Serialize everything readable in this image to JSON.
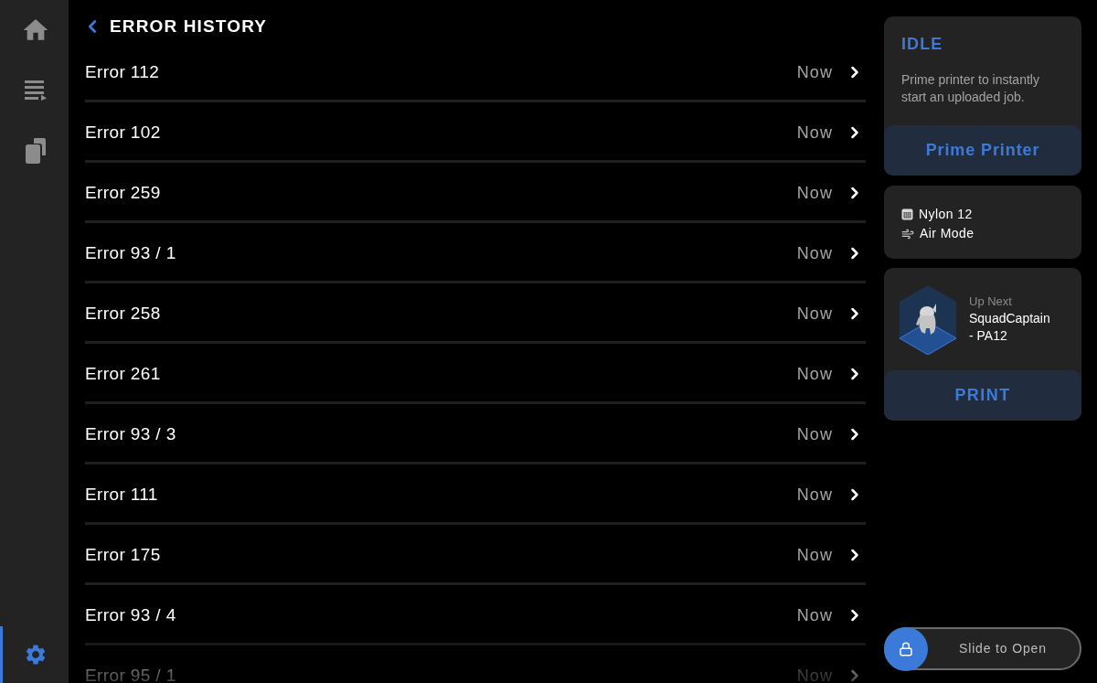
{
  "sidebar": {
    "items": [
      {
        "kind": "home",
        "selected": false
      },
      {
        "kind": "queue",
        "selected": false
      },
      {
        "kind": "library",
        "selected": false
      },
      {
        "kind": "settings",
        "selected": true
      }
    ]
  },
  "header": {
    "title": "ERROR HISTORY"
  },
  "errors": [
    {
      "name": "Error 112",
      "time": "Now"
    },
    {
      "name": "Error 102",
      "time": "Now"
    },
    {
      "name": "Error 259",
      "time": "Now"
    },
    {
      "name": "Error 93 / 1",
      "time": "Now"
    },
    {
      "name": "Error 258",
      "time": "Now"
    },
    {
      "name": "Error 261",
      "time": "Now"
    },
    {
      "name": "Error 93 / 3",
      "time": "Now"
    },
    {
      "name": "Error 111",
      "time": "Now"
    },
    {
      "name": "Error 175",
      "time": "Now"
    },
    {
      "name": "Error 93 / 4",
      "time": "Now"
    },
    {
      "name": "Error 95 / 1",
      "time": "Now"
    }
  ],
  "status_card": {
    "state": "IDLE",
    "description": "Prime printer to instantly start an uploaded job.",
    "button": "Prime Printer"
  },
  "settings_card": {
    "items": [
      {
        "kind": "material",
        "label": "Nylon 12"
      },
      {
        "kind": "mode",
        "label": "Air Mode"
      }
    ]
  },
  "next_job": {
    "caption": "Up Next",
    "name": "SquadCaptain - PA12",
    "button": "PRINT"
  },
  "unlock_slider": {
    "label": "Slide to Open",
    "level": 0
  }
}
